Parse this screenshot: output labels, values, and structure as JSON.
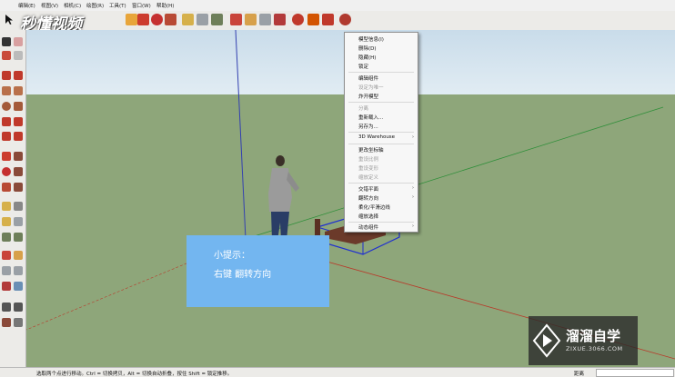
{
  "menu": [
    "编辑(E)",
    "视图(V)",
    "相机(C)",
    "绘图(R)",
    "工具(T)",
    "窗口(W)",
    "帮助(H)"
  ],
  "brand_logo": "秒懂视频",
  "context_menu": {
    "items": [
      {
        "label": "模型信息(I)",
        "disabled": false,
        "submenu": false
      },
      {
        "label": "删除(D)",
        "disabled": false,
        "submenu": false
      },
      {
        "label": "隐藏(H)",
        "disabled": false,
        "submenu": false
      },
      {
        "label": "锁定",
        "disabled": false,
        "submenu": false
      },
      {
        "label": "编辑组件",
        "disabled": false,
        "submenu": false
      },
      {
        "label": "设定为唯一",
        "disabled": true,
        "submenu": false
      },
      {
        "label": "炸开模型",
        "disabled": false,
        "submenu": false
      },
      {
        "label": "分离",
        "disabled": true,
        "submenu": false
      },
      {
        "label": "重新载入...",
        "disabled": false,
        "submenu": false
      },
      {
        "label": "另存为...",
        "disabled": false,
        "submenu": false
      },
      {
        "label": "3D Warehouse",
        "disabled": false,
        "submenu": true
      },
      {
        "label": "更改坐标轴",
        "disabled": false,
        "submenu": false
      },
      {
        "label": "重设比例",
        "disabled": true,
        "submenu": false
      },
      {
        "label": "重设变形",
        "disabled": true,
        "submenu": false
      },
      {
        "label": "缩放定义",
        "disabled": true,
        "submenu": false
      },
      {
        "label": "交错平面",
        "disabled": false,
        "submenu": true
      },
      {
        "label": "翻转方向",
        "disabled": false,
        "submenu": true
      },
      {
        "label": "柔化/平滑边线",
        "disabled": false,
        "submenu": false
      },
      {
        "label": "缩放选择",
        "disabled": false,
        "submenu": false
      },
      {
        "label": "动态组件",
        "disabled": false,
        "submenu": true
      }
    ],
    "submenu_arrow": "›"
  },
  "tip": {
    "title": "小提示：",
    "body": "右键  翻转方向"
  },
  "watermark": {
    "name": "溜溜自学",
    "url": "ZIXUE.3066.COM"
  },
  "status_bar": {
    "message": "选取两个点进行移动。Ctrl = 切换拷贝，Alt = 切换自动折叠，按住 Shift = 锁定推移。",
    "measure_label": "距离",
    "measure_value": ""
  },
  "colors": {
    "sky": "#c9dcea",
    "ground": "#8ea67a",
    "tip_bg": "#73b6f0",
    "axis_red": "#b83a2a",
    "axis_green": "#2f8f3a",
    "axis_blue": "#3340b0",
    "selection": "#1f2fd0"
  },
  "icons": {
    "watermark": "play-triangle-icon",
    "select": "arrow-select-icon"
  }
}
